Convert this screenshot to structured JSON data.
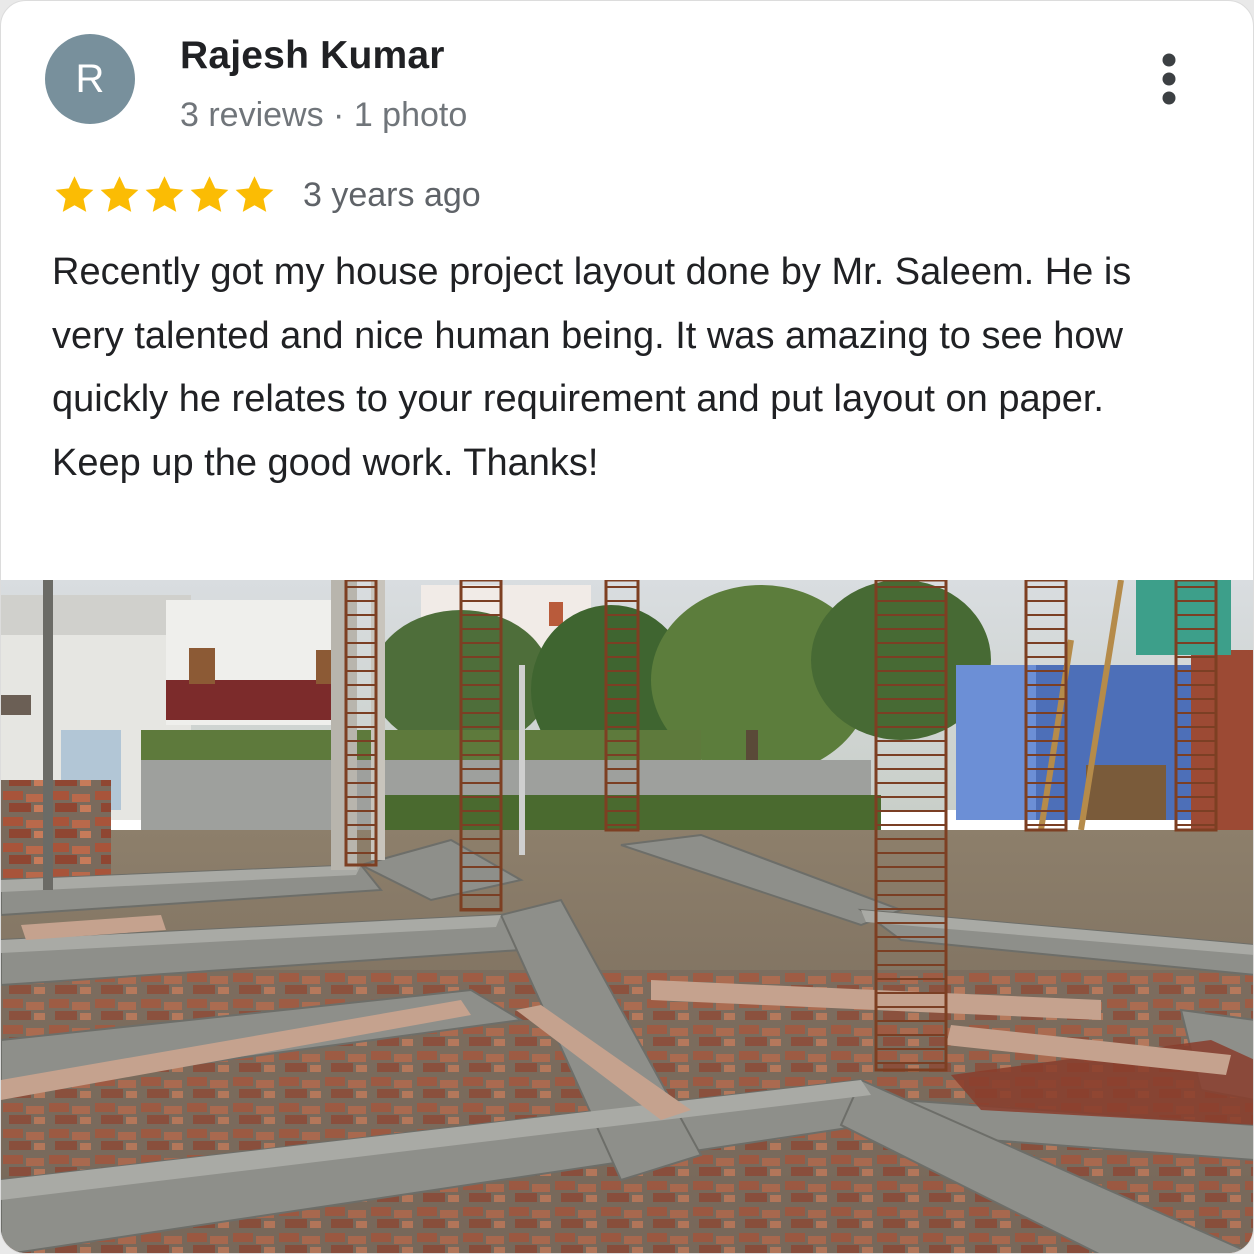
{
  "reviewer": {
    "initial": "R",
    "name": "Rajesh Kumar",
    "meta": "3 reviews · 1 photo",
    "avatar_color": "#78909c"
  },
  "rating": {
    "stars": 5,
    "star_color": "#fbbc04",
    "time": "3 years ago"
  },
  "review_text": "Recently got my house project layout done by Mr. Saleem. He is very talented and nice human being. It was amazing to see how quickly he relates to your requirement and put layout on paper. Keep up the good work. Thanks!",
  "icons": {
    "more": "more-vertical-icon",
    "star": "star-icon"
  },
  "photo": {
    "subject": "construction-foundation-photo"
  }
}
